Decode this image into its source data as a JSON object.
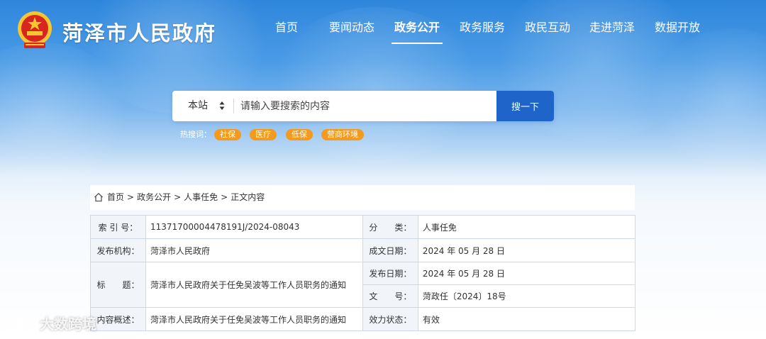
{
  "site": {
    "title": "菏泽市人民政府"
  },
  "nav": [
    {
      "label": "首页",
      "active": false
    },
    {
      "label": "要闻动态",
      "active": false
    },
    {
      "label": "政务公开",
      "active": true
    },
    {
      "label": "政务服务",
      "active": false
    },
    {
      "label": "政民互动",
      "active": false
    },
    {
      "label": "走进菏泽",
      "active": false
    },
    {
      "label": "数据开放",
      "active": false
    }
  ],
  "search": {
    "scope": "本站",
    "placeholder": "请输入要搜索的内容",
    "button": "搜一下"
  },
  "hot": {
    "label": "热搜词：",
    "tags": [
      "社保",
      "医疗",
      "低保",
      "营商环境"
    ]
  },
  "breadcrumb": {
    "items": [
      "首页",
      "政务公开",
      "人事任免",
      "正文内容"
    ],
    "separator": ">"
  },
  "info": {
    "index_label": "索 引 号：",
    "index_value": "11371700004478191J/2024-08043",
    "category_label": "分　　类：",
    "category_value": "人事任免",
    "publisher_label": "发布机构：",
    "publisher_value": "菏泽市人民政府",
    "created_label": "成文日期：",
    "created_value": "2024 年 05 月 28 日",
    "title_label": "标　　题：",
    "title_value": "菏泽市人民政府关于任免吴波等工作人员职务的通知",
    "published_label": "发布日期：",
    "published_value": "2024 年 05 月 28 日",
    "docno_label": "文　　号：",
    "docno_value": "菏政任〔2024〕18号",
    "summary_label": "内容概述：",
    "summary_value": "菏泽市人民政府关于任免吴波等工作人员职务的通知",
    "status_label": "效力状态：",
    "status_value": "有效"
  },
  "watermark": {
    "text": "大数跨境"
  },
  "icons": {
    "emblem": "national-emblem-icon",
    "home": "home-icon",
    "scope_arrow": "sort-arrows-icon",
    "watermark_logo": "wechat-logo-icon"
  },
  "colors": {
    "header_blue": "#2e86dc",
    "search_button": "#1f64c9",
    "hot_tag": "#f39a1f",
    "table_border": "#cfd8e6",
    "table_label_bg": "#f1f4f8"
  }
}
